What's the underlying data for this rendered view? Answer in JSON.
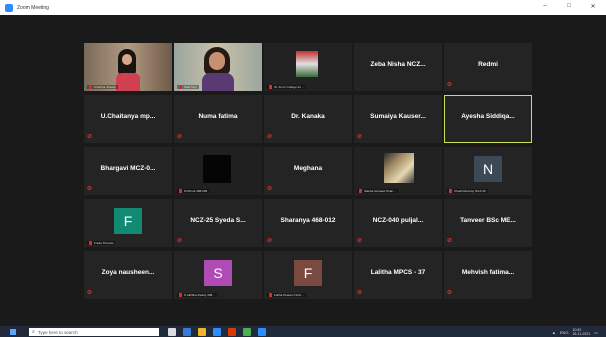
{
  "window": {
    "title": "Zoom Meeting",
    "controls": {
      "minimize": "–",
      "maximize": "□",
      "close": "✕"
    }
  },
  "colors": {
    "stage": "#1a1a1a",
    "tile": "#242424",
    "active_border": "#c8e05a",
    "muted": "#e02828"
  },
  "participants": [
    {
      "kind": "video",
      "caption": "Charitha Jhawar",
      "photo": "woman-dark-hair"
    },
    {
      "kind": "video",
      "caption": "Sital Yam",
      "photo": "woman-glasses"
    },
    {
      "kind": "video",
      "caption": "St. Ann's College for ...",
      "photo": "college-image"
    },
    {
      "kind": "name",
      "name": "Zeba Nisha NCZ...",
      "muted": false
    },
    {
      "kind": "name",
      "name": "Redmi",
      "muted": true
    },
    {
      "kind": "name",
      "name": "U.Chaitanya mp...",
      "muted": true
    },
    {
      "kind": "name",
      "name": "Numa fatima",
      "muted": true
    },
    {
      "kind": "name",
      "name": "Dr. Kanaka",
      "muted": true
    },
    {
      "kind": "name",
      "name": "Sumaiya Kauser...",
      "muted": true
    },
    {
      "kind": "name",
      "name": "Ayesha Siddiqa...",
      "muted": false,
      "active": true
    },
    {
      "kind": "name",
      "name": "Bhargavi MCZ-0...",
      "muted": true
    },
    {
      "kind": "video",
      "caption": "M Dhruti 468-009",
      "photo": "dark-screen"
    },
    {
      "kind": "name",
      "name": "Meghana",
      "muted": true
    },
    {
      "kind": "video",
      "caption": "Saleha Gulnaaz Khan...",
      "photo": "landscape"
    },
    {
      "kind": "avatar",
      "letter": "N",
      "avatar_color": "#3d4a55",
      "caption": "Chedli Revinay NCZ-30"
    },
    {
      "kind": "avatar",
      "letter": "F",
      "avatar_color": "#128a73",
      "caption": "Freda Thomas"
    },
    {
      "kind": "name",
      "name": "NCZ-25 Syeda S...",
      "muted": true
    },
    {
      "kind": "name",
      "name": "Sharanya 468-012",
      "muted": true
    },
    {
      "kind": "name",
      "name": "NCZ-040 puljal...",
      "muted": true
    },
    {
      "kind": "name",
      "name": "Tanveer BSc ME...",
      "muted": true
    },
    {
      "kind": "name",
      "name": "Zoya nausheen...",
      "muted": true
    },
    {
      "kind": "avatar",
      "letter": "S",
      "avatar_color": "#b04bb6",
      "caption": "S.Akhitha Reddy 468..."
    },
    {
      "kind": "avatar",
      "letter": "F",
      "avatar_color": "#7a4a40",
      "caption": "Fatiha Kharam NCZ-..."
    },
    {
      "kind": "name",
      "name": "Lalitha MPCS - 37",
      "muted": true
    },
    {
      "kind": "name",
      "name": "Mehvish fatima...",
      "muted": true
    }
  ],
  "taskbar": {
    "search_placeholder": "Type here to search",
    "tray": {
      "lang": "ENG",
      "time": "10:52",
      "date": "26-11-2021"
    }
  }
}
